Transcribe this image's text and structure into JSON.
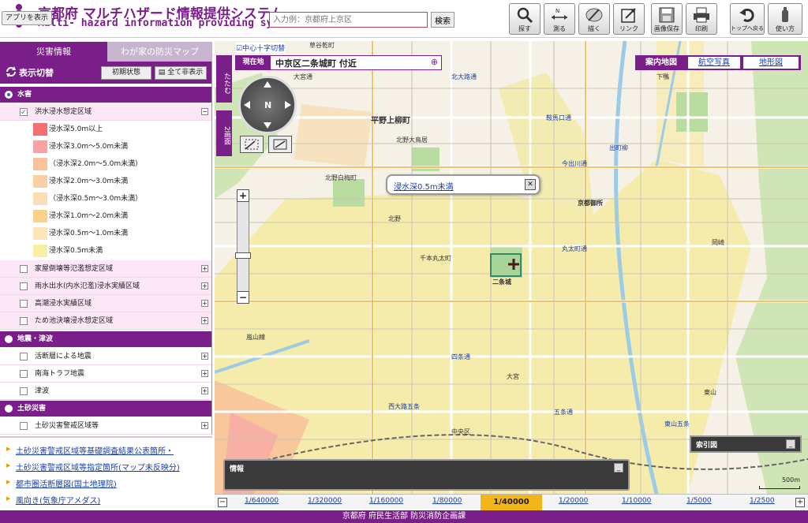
{
  "header": {
    "app_button": "アプリを表示",
    "title_ja": "京都府 マルチハザード情報提供システム",
    "title_en": "Multi- hazard information providing system",
    "search_placeholder": "入力例：京都府上京区",
    "search_button": "検索"
  },
  "toolbar": [
    {
      "label": "探す",
      "icon": "magnifier-icon"
    },
    {
      "label": "測る",
      "icon": "measure-icon"
    },
    {
      "label": "描く",
      "icon": "draw-icon"
    },
    {
      "label": "リンク",
      "icon": "link-icon"
    },
    {
      "label": "画像保存",
      "icon": "save-image-icon"
    },
    {
      "label": "印刷",
      "icon": "print-icon"
    },
    {
      "label": "トップへ戻る",
      "icon": "back-top-icon"
    },
    {
      "label": "使い方",
      "icon": "help-icon"
    }
  ],
  "tabs": {
    "disaster": "災害情報",
    "home": "わが家の防災マップ"
  },
  "sidebar": {
    "display_title": "表示切替",
    "init_button": "初期状態",
    "hide_all_button": "全て非表示",
    "categories": [
      {
        "label": "水害",
        "selected": true
      },
      {
        "label": "地震・津波",
        "selected": false
      },
      {
        "label": "土砂災害",
        "selected": false
      }
    ],
    "flood_layers": [
      {
        "label": "洪水浸水想定区域",
        "checked": true,
        "expanded": true
      },
      {
        "label": "家屋倒壊等氾濫想定区域",
        "checked": false
      },
      {
        "label": "雨水出水(内水氾濫)浸水実績区域",
        "checked": false
      },
      {
        "label": "高潮浸水実績区域",
        "checked": false
      },
      {
        "label": "ため池決壊浸水想定区域",
        "checked": false
      }
    ],
    "legend": [
      {
        "label": "浸水深5.0m以上",
        "color": "#f46f6f"
      },
      {
        "label": "浸水深3.0m～5.0m未満",
        "color": "#f7a3a3"
      },
      {
        "label": "（浸水深2.0m～5.0m未満）",
        "color": "#f9c29a"
      },
      {
        "label": "浸水深2.0m～3.0m未満",
        "color": "#fbcfa6"
      },
      {
        "label": "（浸水深0.5m～3.0m未満）",
        "color": "#f9ddb5"
      },
      {
        "label": "浸水深1.0m～2.0m未満",
        "color": "#f8d38a"
      },
      {
        "label": "浸水深0.5m～1.0m未満",
        "color": "#fae6b8"
      },
      {
        "label": "浸水深0.5m未満",
        "color": "#f6f0a6"
      }
    ],
    "quake_layers": [
      {
        "label": "活断層による地震"
      },
      {
        "label": "南海トラフ地震"
      },
      {
        "label": "津波"
      }
    ],
    "sediment_layers": [
      {
        "label": "土砂災害警戒区域等"
      }
    ]
  },
  "links": [
    "土砂災害警戒区域等基礎調査結果公表箇所・",
    "土砂災害警戒区域等指定箇所(マップ未反映分)",
    "都市圏活断層図(国土地理院)",
    "風向き(気象庁アメダス)"
  ],
  "map": {
    "center_checkbox": "中心十字切替",
    "current_tag": "現在地",
    "current_location": "中京区二条城町 付近",
    "collapse_tab": "たたむ",
    "split_tab": "2画面",
    "popup_text": "浸水深0.5m未満",
    "map_tabs": [
      "案内地図",
      "航空写真",
      "地形図"
    ],
    "info_panel": "情報",
    "index_panel": "索引図",
    "scale_legend": "500m",
    "labels": [
      "草谷乾町",
      "平野上柳町",
      "大宮通",
      "北大路通",
      "北野大鳥居",
      "北野白梅町",
      "鞍馬口通",
      "今出川通",
      "丸太町通",
      "二条城",
      "四条通",
      "西大路五条",
      "五条通",
      "嵐山線",
      "北野",
      "千本丸太町",
      "東山五条",
      "岡崎",
      "下鴨",
      "出町柳",
      "京都御所",
      "中央区",
      "大宮",
      "東山"
    ]
  },
  "scales": [
    "1/640000",
    "1/320000",
    "1/160000",
    "1/80000",
    "1/40000",
    "1/20000",
    "1/10000",
    "1/5000",
    "1/2500"
  ],
  "active_scale": "1/40000",
  "footer": "京都府 府民生活部 防災消防企画課"
}
